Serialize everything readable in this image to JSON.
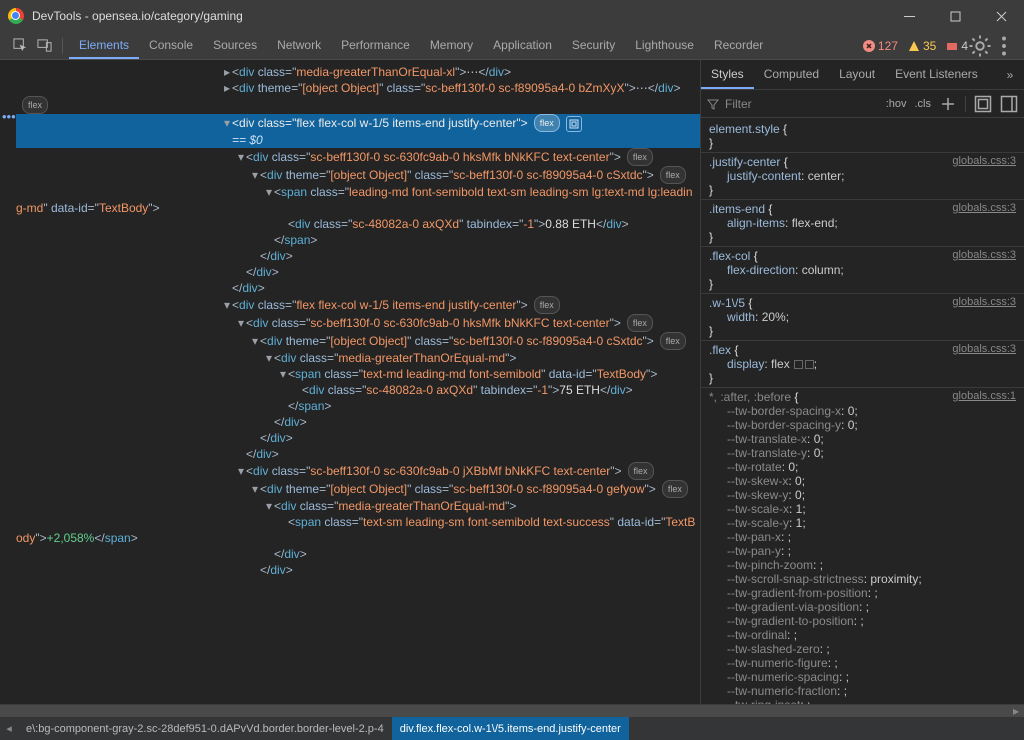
{
  "window": {
    "title": "DevTools - opensea.io/category/gaming"
  },
  "toolbar": {
    "tabs": [
      "Elements",
      "Console",
      "Sources",
      "Network",
      "Performance",
      "Memory",
      "Application",
      "Security",
      "Lighthouse",
      "Recorder"
    ],
    "activeTab": 0,
    "errors": "127",
    "warnings": "35",
    "infos": "4"
  },
  "dom": {
    "lines": [
      {
        "indent": 216,
        "caret": "closed",
        "html": "<div class=\"media-greaterThanOrEqual-xl\">…</div>",
        "badge": "",
        "sel": false
      },
      {
        "indent": 216,
        "caret": "closed",
        "html": "<div theme=\"[object Object]\" class=\"sc-beff130f-0 sc-f89095a4-0 bZmXyX\">…</div>",
        "badge": "flex",
        "sel": false
      },
      {
        "indent": 216,
        "caret": "open",
        "html": "<div class=\"flex flex-col w-1/5 items-end justify-center\">",
        "badge": "flex",
        "sel": true,
        "eq0": "== $0",
        "roundbtn": true
      },
      {
        "indent": 230,
        "caret": "open",
        "html": "<div class=\"sc-beff130f-0 sc-630fc9ab-0 hksMfk bNkKFC text-center\">",
        "badge": "flex"
      },
      {
        "indent": 244,
        "caret": "open",
        "html": "<div theme=\"[object Object]\" class=\"sc-beff130f-0 sc-f89095a4-0 cSxtdc\">",
        "badge": "flex"
      },
      {
        "indent": 258,
        "caret": "open",
        "html": "<span class=\"leading-md font-semibold text-sm leading-sm lg:text-md lg:leading-md\" data-id=\"TextBody\">"
      },
      {
        "indent": 272,
        "caret": "",
        "html": "<div class=\"sc-48082a-0 axQXd\" tabindex=\"-1\">0.88 ETH</div>"
      },
      {
        "indent": 258,
        "caret": "",
        "html": "</span>"
      },
      {
        "indent": 244,
        "caret": "",
        "html": "</div>"
      },
      {
        "indent": 230,
        "caret": "",
        "html": "</div>"
      },
      {
        "indent": 216,
        "caret": "",
        "html": "</div>"
      },
      {
        "indent": 216,
        "caret": "open",
        "html": "<div class=\"flex flex-col w-1/5 items-end justify-center\">",
        "badge": "flex"
      },
      {
        "indent": 230,
        "caret": "open",
        "html": "<div class=\"sc-beff130f-0 sc-630fc9ab-0 hksMfk bNkKFC text-center\">",
        "badge": "flex"
      },
      {
        "indent": 244,
        "caret": "open",
        "html": "<div theme=\"[object Object]\" class=\"sc-beff130f-0 sc-f89095a4-0 cSxtdc\">",
        "badge": "flex"
      },
      {
        "indent": 258,
        "caret": "open",
        "html": "<div class=\"media-greaterThanOrEqual-md\">"
      },
      {
        "indent": 272,
        "caret": "open",
        "html": "<span class=\"text-md leading-md font-semibold\" data-id=\"TextBody\">"
      },
      {
        "indent": 286,
        "caret": "",
        "html": "<div class=\"sc-48082a-0 axQXd\" tabindex=\"-1\">75 ETH</div>"
      },
      {
        "indent": 272,
        "caret": "",
        "html": "</span>"
      },
      {
        "indent": 258,
        "caret": "",
        "html": "</div>"
      },
      {
        "indent": 244,
        "caret": "",
        "html": "</div>"
      },
      {
        "indent": 230,
        "caret": "",
        "html": "</div>"
      },
      {
        "indent": 230,
        "caret": "open",
        "html": "<div class=\"sc-beff130f-0 sc-630fc9ab-0 jXBbMf bNkKFC text-center\">",
        "badge": "flex"
      },
      {
        "indent": 244,
        "caret": "open",
        "html": "<div theme=\"[object Object]\" class=\"sc-beff130f-0 sc-f89095a4-0 gefyow\">",
        "badge": "flex"
      },
      {
        "indent": 258,
        "caret": "open",
        "html": "<div class=\"media-greaterThanOrEqual-md\">"
      },
      {
        "indent": 272,
        "caret": "",
        "html": "<span class=\"text-sm leading-sm font-semibold text-success\" data-id=\"TextBody\">+2,058%</span>",
        "green": "+2,058%"
      },
      {
        "indent": 258,
        "caret": "",
        "html": "</div>"
      },
      {
        "indent": 244,
        "caret": "",
        "html": "</div>"
      }
    ]
  },
  "stylesPanel": {
    "tabs": [
      "Styles",
      "Computed",
      "Layout",
      "Event Listeners"
    ],
    "activeTab": 0,
    "filterPlaceholder": "Filter",
    "hov": ":hov",
    "cls": ".cls"
  },
  "rules": [
    {
      "selector": "element.style",
      "src": "",
      "decls": []
    },
    {
      "selector": ".justify-center",
      "src": "globals.css:3",
      "decls": [
        {
          "p": "justify-content",
          "v": "center"
        }
      ]
    },
    {
      "selector": ".items-end",
      "src": "globals.css:3",
      "decls": [
        {
          "p": "align-items",
          "v": "flex-end"
        }
      ]
    },
    {
      "selector": ".flex-col",
      "src": "globals.css:3",
      "decls": [
        {
          "p": "flex-direction",
          "v": "column"
        }
      ]
    },
    {
      "selector": ".w-1\\/5",
      "src": "globals.css:3",
      "decls": [
        {
          "p": "width",
          "v": "20%"
        }
      ]
    },
    {
      "selector": ".flex",
      "src": "globals.css:3",
      "decls": [
        {
          "p": "display",
          "v": "flex",
          "chips": true
        }
      ]
    }
  ],
  "starRule": {
    "selector": "*, :after, :before",
    "src": "globals.css:1",
    "decls": [
      {
        "p": "--tw-border-spacing-x",
        "v": "0"
      },
      {
        "p": "--tw-border-spacing-y",
        "v": "0"
      },
      {
        "p": "--tw-translate-x",
        "v": "0"
      },
      {
        "p": "--tw-translate-y",
        "v": "0"
      },
      {
        "p": "--tw-rotate",
        "v": "0"
      },
      {
        "p": "--tw-skew-x",
        "v": "0"
      },
      {
        "p": "--tw-skew-y",
        "v": "0"
      },
      {
        "p": "--tw-scale-x",
        "v": "1"
      },
      {
        "p": "--tw-scale-y",
        "v": "1"
      },
      {
        "p": "--tw-pan-x",
        "v": "",
        "sq": true
      },
      {
        "p": "--tw-pan-y",
        "v": "",
        "sq": true
      },
      {
        "p": "--tw-pinch-zoom",
        "v": "",
        "sq": true
      },
      {
        "p": "--tw-scroll-snap-strictness",
        "v": "proximity"
      },
      {
        "p": "--tw-gradient-from-position",
        "v": "",
        "sq": true
      },
      {
        "p": "--tw-gradient-via-position",
        "v": "",
        "sq": true
      },
      {
        "p": "--tw-gradient-to-position",
        "v": "",
        "sq": true
      },
      {
        "p": "--tw-ordinal",
        "v": "",
        "sq": true
      },
      {
        "p": "--tw-slashed-zero",
        "v": "",
        "sq": true
      },
      {
        "p": "--tw-numeric-figure",
        "v": "",
        "sq": true
      },
      {
        "p": "--tw-numeric-spacing",
        "v": "",
        "sq": true
      },
      {
        "p": "--tw-numeric-fraction",
        "v": "",
        "sq": true
      },
      {
        "p": "--tw-ring-inset",
        "v": "",
        "sq": true
      }
    ]
  },
  "breadcrumbs": {
    "left": "e\\:bg-component-gray-2.sc-28def951-0.dAPvVd.border.border-level-2.p-4",
    "right": "div.flex.flex-col.w-1\\/5.items-end.justify-center"
  }
}
